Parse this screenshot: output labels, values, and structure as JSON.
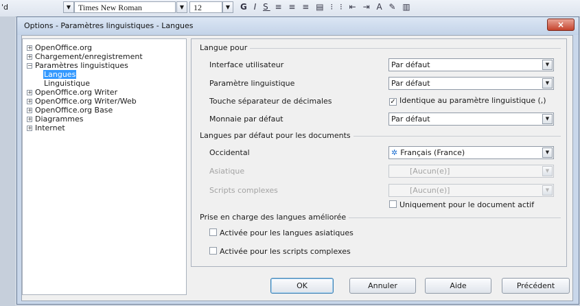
{
  "toolbar": {
    "stub": "'d",
    "font_name": "Times New Roman",
    "font_size": "12"
  },
  "dialog": {
    "title": "Options - Paramètres linguistiques - Langues",
    "close_glyph": "×"
  },
  "tree": {
    "items": [
      {
        "label": "OpenOffice.org",
        "level": 0,
        "expander": "+"
      },
      {
        "label": "Chargement/enregistrement",
        "level": 0,
        "expander": "+"
      },
      {
        "label": "Paramètres linguistiques",
        "level": 0,
        "expander": "−"
      },
      {
        "label": "Langues",
        "level": 1,
        "selected": true
      },
      {
        "label": "Linguistique",
        "level": 1
      },
      {
        "label": "OpenOffice.org Writer",
        "level": 0,
        "expander": "+"
      },
      {
        "label": "OpenOffice.org Writer/Web",
        "level": 0,
        "expander": "+"
      },
      {
        "label": "OpenOffice.org Base",
        "level": 0,
        "expander": "+"
      },
      {
        "label": "Diagrammes",
        "level": 0,
        "expander": "+"
      },
      {
        "label": "Internet",
        "level": 0,
        "expander": "+"
      }
    ]
  },
  "langue_pour": {
    "heading": "Langue pour",
    "interface_label": "Interface utilisateur",
    "interface_value": "Par défaut",
    "parametre_label": "Paramètre linguistique",
    "parametre_value": "Par défaut",
    "separateur_label": "Touche séparateur de décimales",
    "separateur_check_label": "Identique au paramètre linguistique (,)",
    "separateur_checked": true,
    "monnaie_label": "Monnaie par défaut",
    "monnaie_value": "Par défaut"
  },
  "langues_defaut": {
    "heading": "Langues par défaut pour les documents",
    "occidental_label": "Occidental",
    "occidental_value": "Français (France)",
    "asiatique_label": "Asiatique",
    "asiatique_value": "[Aucun(e)]",
    "scripts_label": "Scripts complexes",
    "scripts_value": "[Aucun(e)]",
    "doc_actif_label": "Uniquement pour le document actif",
    "doc_actif_checked": false
  },
  "prise_en_charge": {
    "heading": "Prise en charge des langues améliorée",
    "asiatiques_label": "Activée pour les langues asiatiques",
    "asiatiques_checked": false,
    "complexes_label": "Activée pour les scripts complexes",
    "complexes_checked": false
  },
  "buttons": {
    "ok": "OK",
    "annuler": "Annuler",
    "aide": "Aide",
    "precedent": "Précédent"
  }
}
